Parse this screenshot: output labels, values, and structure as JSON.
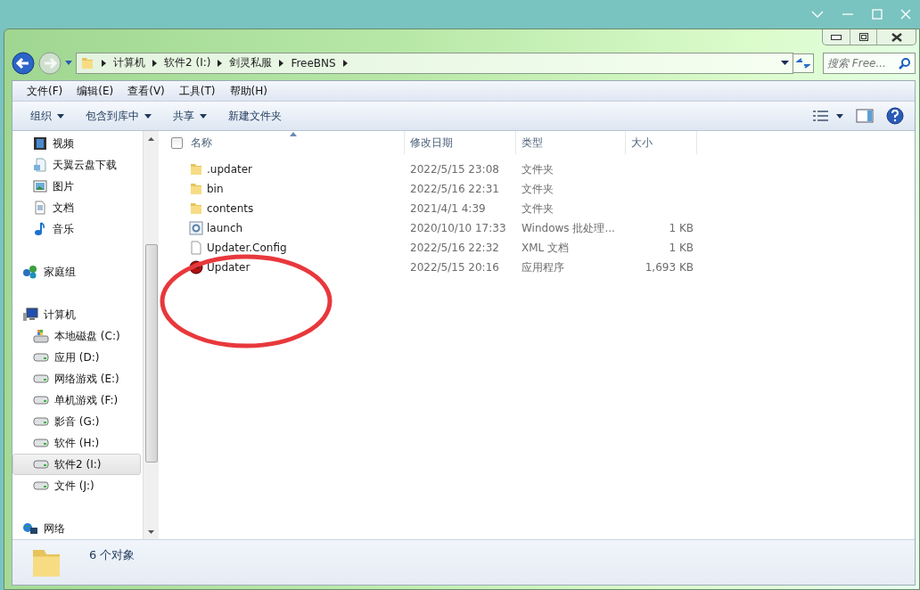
{
  "breadcrumb": [
    "计算机",
    "软件2 (I:)",
    "剑灵私服",
    "FreeBNS"
  ],
  "search": {
    "placeholder": "搜索 Free..."
  },
  "menu": [
    "文件(F)",
    "编辑(E)",
    "查看(V)",
    "工具(T)",
    "帮助(H)"
  ],
  "toolbar": [
    {
      "label": "组织",
      "dropdown": true
    },
    {
      "label": "包含到库中",
      "dropdown": true
    },
    {
      "label": "共享",
      "dropdown": true
    },
    {
      "label": "新建文件夹",
      "dropdown": false
    }
  ],
  "sidebar": {
    "groups": [
      {
        "children": [
          {
            "label": "视频",
            "kind": "video",
            "selected": false
          },
          {
            "label": "天翼云盘下载",
            "kind": "download",
            "selected": false
          },
          {
            "label": "图片",
            "kind": "pictures",
            "selected": false
          },
          {
            "label": "文档",
            "kind": "documents",
            "selected": false
          },
          {
            "label": "音乐",
            "kind": "music",
            "selected": false
          }
        ]
      },
      {
        "label": "家庭组",
        "kind": "homegroup",
        "selected": false
      },
      {
        "label": "计算机",
        "kind": "computer",
        "selected": false,
        "children": [
          {
            "label": "本地磁盘 (C:)",
            "kind": "system-drive",
            "selected": false
          },
          {
            "label": "应用 (D:)",
            "kind": "drive",
            "selected": false
          },
          {
            "label": "网络游戏 (E:)",
            "kind": "drive",
            "selected": false
          },
          {
            "label": "单机游戏 (F:)",
            "kind": "drive",
            "selected": false
          },
          {
            "label": "影音 (G:)",
            "kind": "drive",
            "selected": false
          },
          {
            "label": "软件 (H:)",
            "kind": "drive",
            "selected": false
          },
          {
            "label": "软件2 (I:)",
            "kind": "drive",
            "selected": true
          },
          {
            "label": "文件 (J:)",
            "kind": "drive",
            "selected": false
          }
        ]
      },
      {
        "label": "网络",
        "kind": "network",
        "selected": false
      }
    ]
  },
  "table": {
    "select_all": {
      "checked": false
    },
    "columns": [
      "名称",
      "修改日期",
      "类型",
      "大小"
    ],
    "rows": [
      {
        "kind": "folder",
        "name": ".updater",
        "date": "2022/5/15 23:08",
        "type": "文件夹"
      },
      {
        "kind": "folder",
        "name": "bin",
        "date": "2022/5/16 22:31",
        "type": "文件夹"
      },
      {
        "kind": "folder",
        "name": "contents",
        "date": "2021/4/1 4:39",
        "type": "文件夹"
      },
      {
        "kind": "batch",
        "name": "launch",
        "date": "2020/10/10 17:33",
        "type": "Windows 批处理...",
        "size": "1 KB"
      },
      {
        "kind": "document",
        "name": "Updater.Config",
        "date": "2022/5/16 22:32",
        "type": "XML 文档",
        "size": "1 KB"
      },
      {
        "kind": "app",
        "name": "Updater",
        "date": "2022/5/15 20:16",
        "type": "应用程序",
        "size": "1,693 KB"
      }
    ]
  },
  "status_bar": {
    "count": "6 个对象"
  }
}
